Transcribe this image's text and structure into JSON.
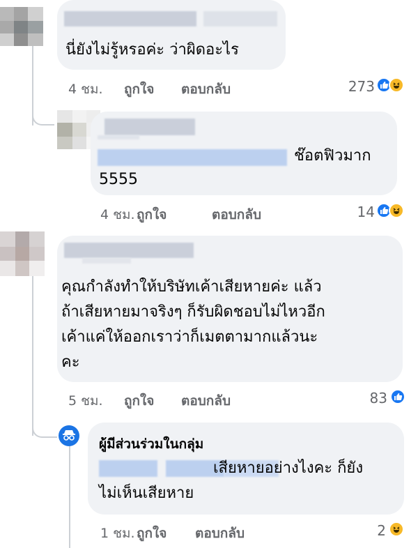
{
  "comments": [
    {
      "text_lines": [
        "นี่ยังไม่รู้หรอค่ะ ว่าผิดอะไร"
      ],
      "time": "4 ชม.",
      "like_label": "ถูกใจ",
      "reply_label": "ตอบกลับ",
      "reaction_count": "273",
      "reactions": [
        "like",
        "haha"
      ]
    },
    {
      "text_lines": [
        "ช๊อตฟิวมาก",
        "5555"
      ],
      "time": "4 ชม.",
      "like_label": "ถูกใจ",
      "reply_label": "ตอบกลับ",
      "reaction_count": "14",
      "reactions": [
        "like",
        "haha"
      ]
    },
    {
      "text_lines": [
        "คุณกำลังทำให้บริษัทเค้าเสียหายค่ะ แล้ว",
        "ถ้าเสียหายมาจริงๆ ก็รับผิดชอบไม่ไหวอีก",
        "เค้าแค่ให้ออกเราว่าก็เมตตามากแล้วนะ",
        "คะ"
      ],
      "time": "5 ชม.",
      "like_label": "ถูกใจ",
      "reply_label": "ตอบกลับ",
      "reaction_count": "83",
      "reactions": [
        "like"
      ]
    },
    {
      "author": "ผู้มีส่วนร่วมในกลุ่ม",
      "text_lines": [
        "เสียหายอย่างไงคะ ก็ยัง",
        "ไม่เห็นเสียหาย"
      ],
      "time": "1 ชม.",
      "like_label": "ถูกใจ",
      "reply_label": "ตอบกลับ",
      "reaction_count": "2",
      "reactions": [
        "haha"
      ]
    }
  ],
  "colors": {
    "bubble": "#f0f2f5",
    "meta": "#65676b",
    "like": "#1877f2",
    "haha": "#f7b928"
  },
  "icons": [
    "blurred-avatar",
    "anonymous-member-icon",
    "like-reaction-icon",
    "haha-reaction-icon"
  ]
}
